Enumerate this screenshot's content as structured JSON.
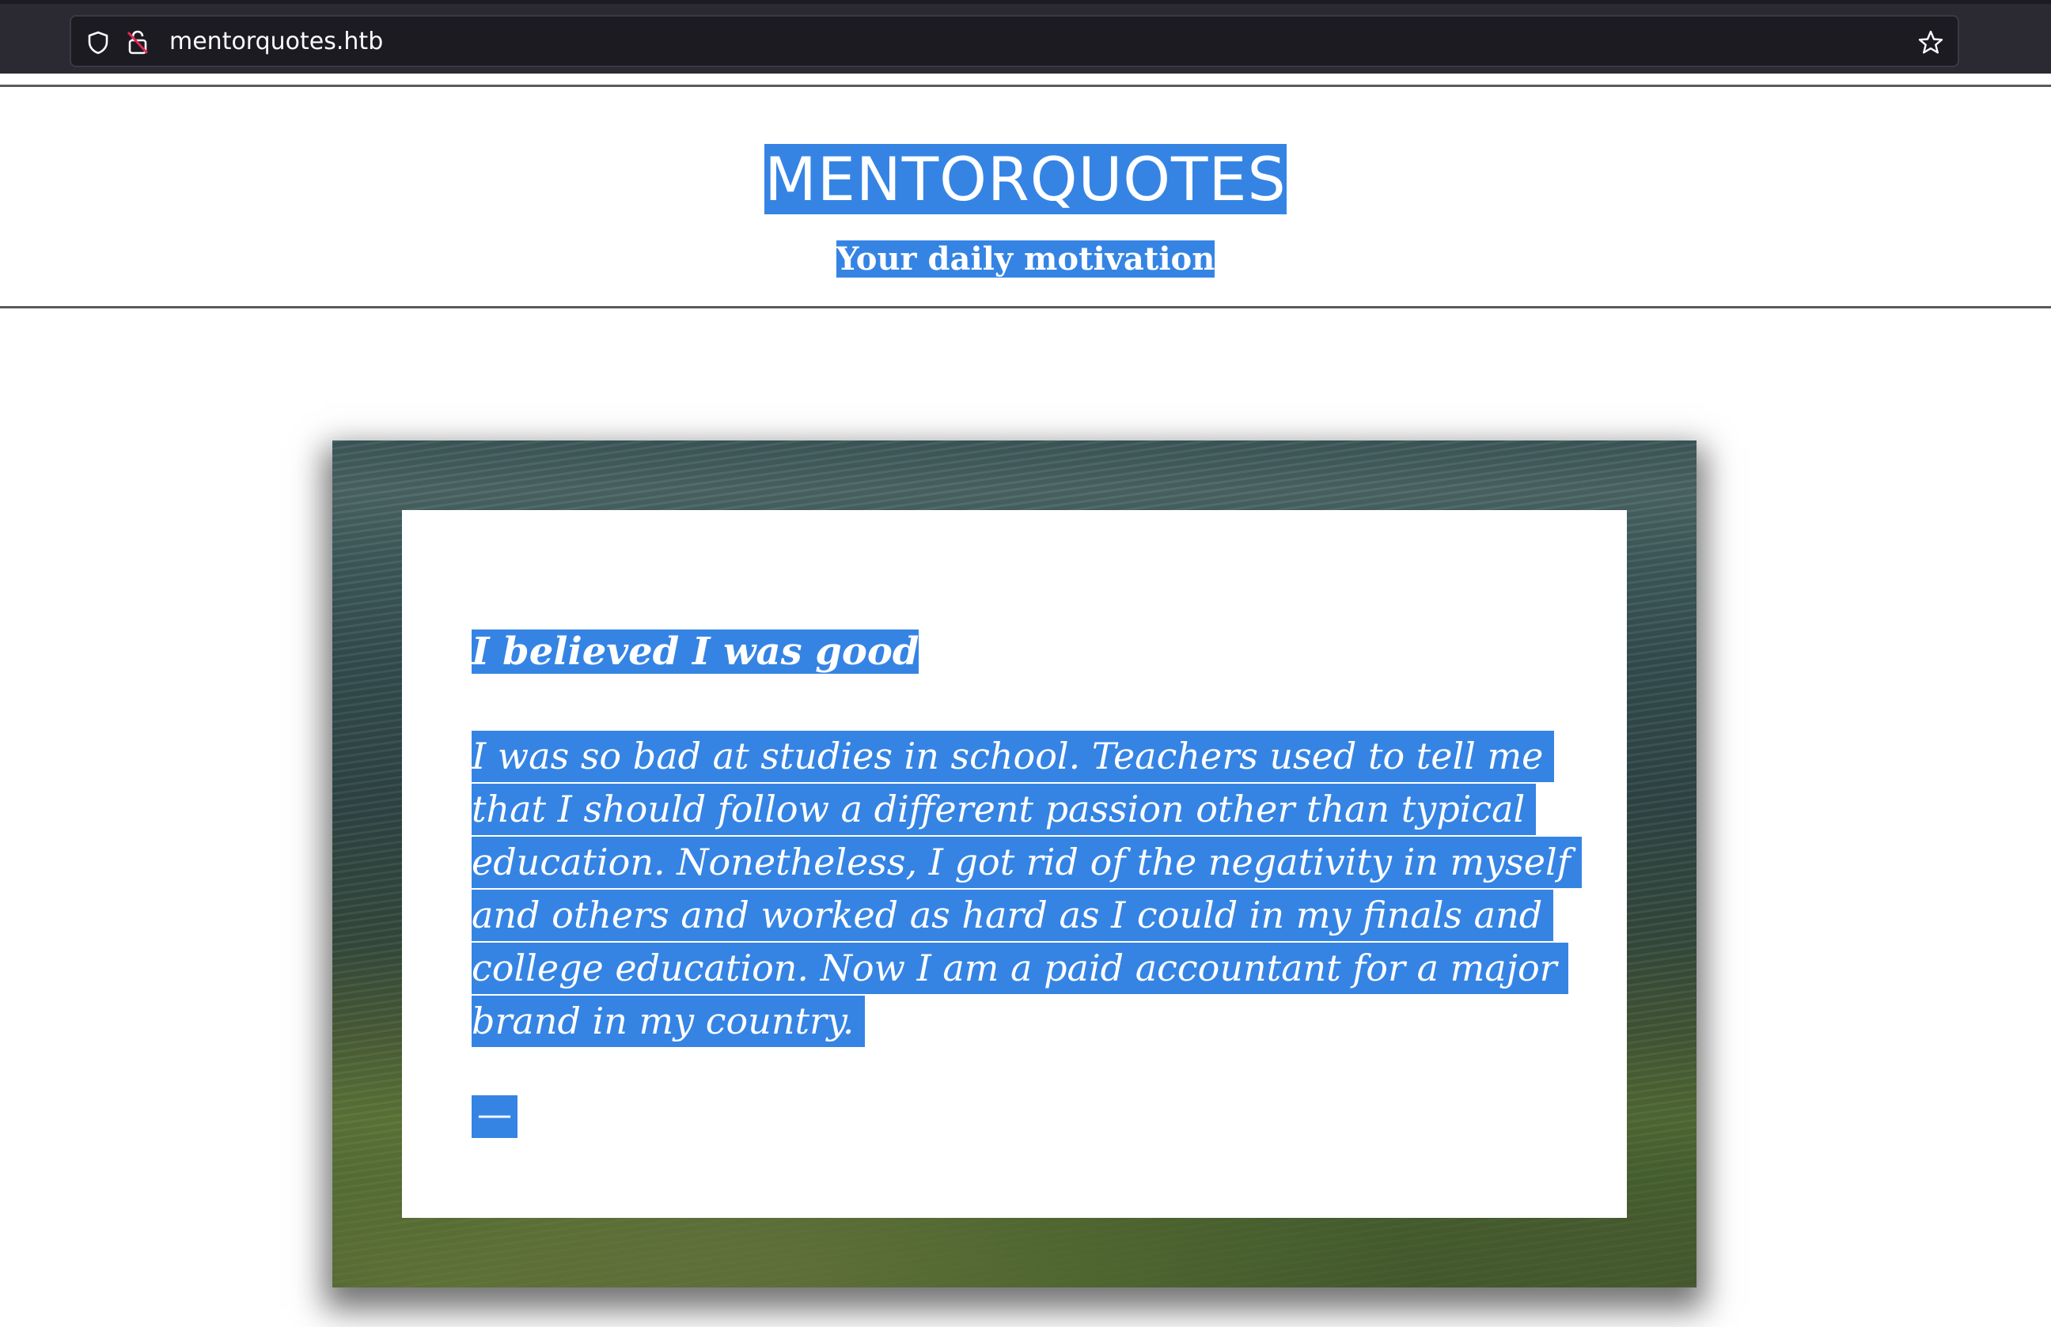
{
  "browser": {
    "url": "mentorquotes.htb",
    "icons": [
      "shield-icon",
      "lock-icon",
      "star-icon"
    ]
  },
  "header": {
    "title": "MENTORQUOTES",
    "subtitle": "Your daily motivation"
  },
  "quote": {
    "title": "I believed I was good",
    "body": "I was so bad at studies in school. Teachers used to tell me that I should follow a different passion other than typical education. Nonetheless, I got rid of the negativity in myself and others and worked as hard as I could in my finals and college education. Now I am a paid accountant for a major brand in my country.",
    "author": "—"
  },
  "colors": {
    "selection": "#3584e4",
    "browser_bar": "#2b2a33"
  }
}
